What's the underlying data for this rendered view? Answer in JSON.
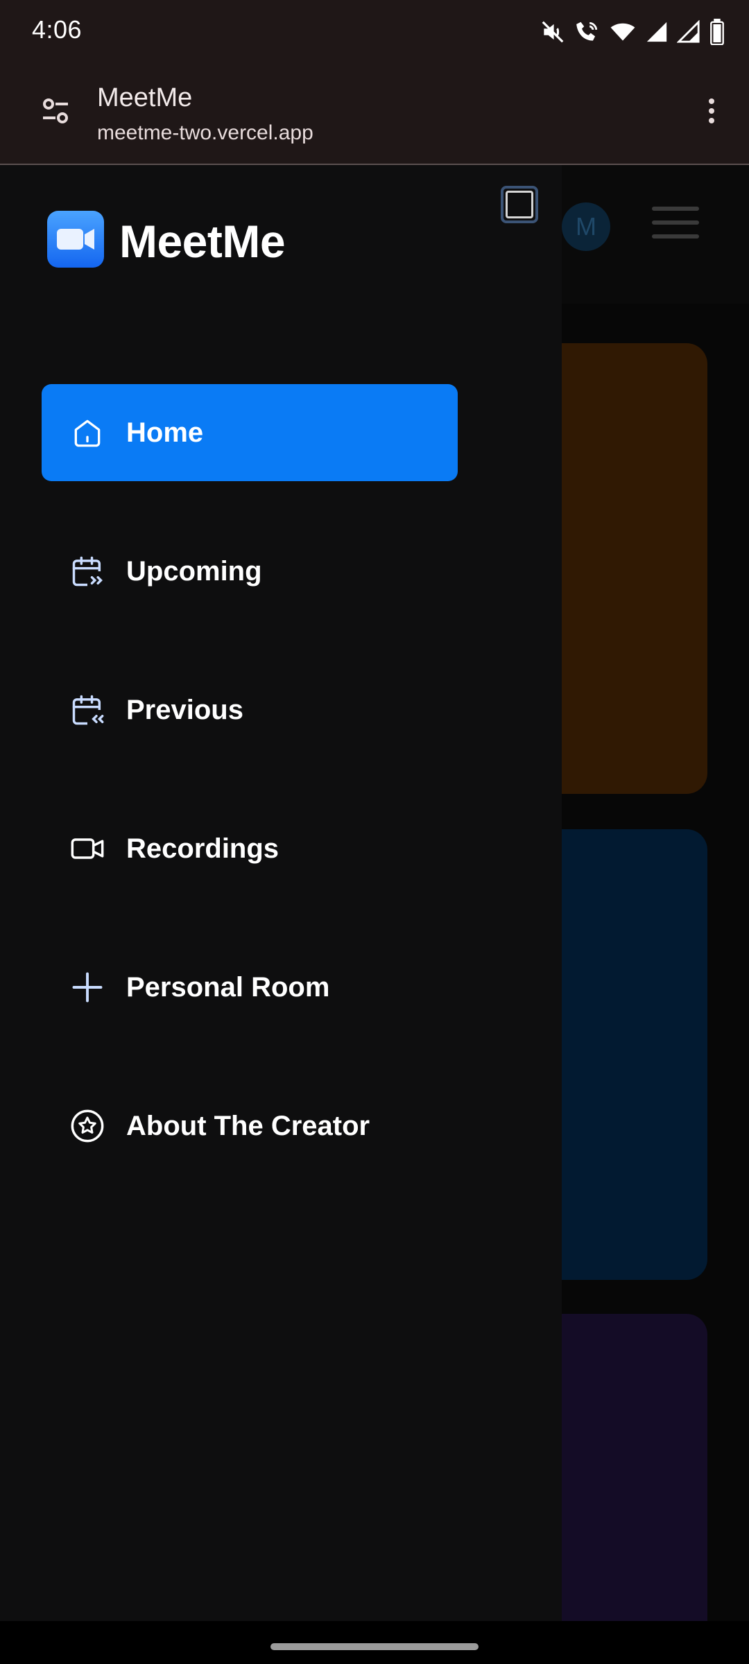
{
  "status_bar": {
    "time": "4:06",
    "icons": [
      "mute-icon",
      "wifi-calling-icon",
      "wifi-icon",
      "signal-icon",
      "signal-icon",
      "battery-icon"
    ]
  },
  "browser": {
    "title": "MeetMe",
    "url": "meetme-two.vercel.app"
  },
  "background_page": {
    "avatar_letter": "M"
  },
  "drawer": {
    "brand": "MeetMe",
    "nav_items": [
      {
        "label": "Home",
        "icon": "home-icon",
        "active": true
      },
      {
        "label": "Upcoming",
        "icon": "calendar-forward-icon",
        "active": false
      },
      {
        "label": "Previous",
        "icon": "calendar-back-icon",
        "active": false
      },
      {
        "label": "Recordings",
        "icon": "video-icon",
        "active": false
      },
      {
        "label": "Personal Room",
        "icon": "plus-icon",
        "active": false
      },
      {
        "label": "About The Creator",
        "icon": "star-badge-icon",
        "active": false
      }
    ]
  },
  "colors": {
    "accent": "#0a7bf5",
    "drawer_bg": "#0e0e0f",
    "browser_bar_bg": "#1f1717"
  }
}
